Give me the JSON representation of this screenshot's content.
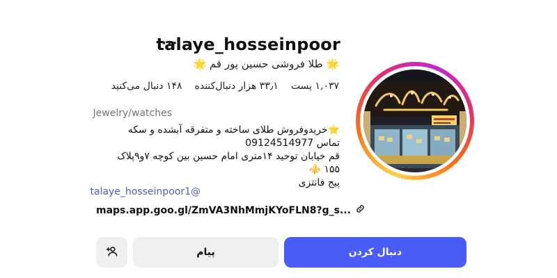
{
  "profile": {
    "username": "talaye_hosseinpoor",
    "more_icon": "more-horizontal-icon",
    "full_name": "🌟 طلا فروشی حسین پور قم 🌟",
    "stats": {
      "posts": "۱,۰۳۷ پست",
      "followers": "۳۳٫۱ هزار دنبال‌کننده",
      "following": "۱۴۸ دنبال می‌کنید"
    },
    "category": "Jewelry/watches",
    "bio_lines": [
      "⭐خریدوفروش طلای ساخته و متفرقه آبشده و سکه",
      "تماس 09124514977",
      "قم خیابان توحید ۱۴متری امام حسین بین کوچه ۷و۹پلاک",
      "۱۵۵ ⚜️",
      "پیج فانتزی"
    ],
    "bio_handle": "talaye_hosseinpoor1@",
    "link": "maps.app.goo.gl/ZmVA3NhMmjKYoFLN8?g_s...",
    "link_icon": "link-icon",
    "avatar_sign_text": "طلای حسین پور"
  },
  "actions": {
    "follow_label": "دنبال کردن",
    "message_label": "پیام",
    "suggest_icon": "add-person-icon"
  },
  "colors": {
    "accent": "#4a5df9",
    "secondary_button": "#efefef",
    "link": "#4f5bd5",
    "muted": "#737373"
  }
}
